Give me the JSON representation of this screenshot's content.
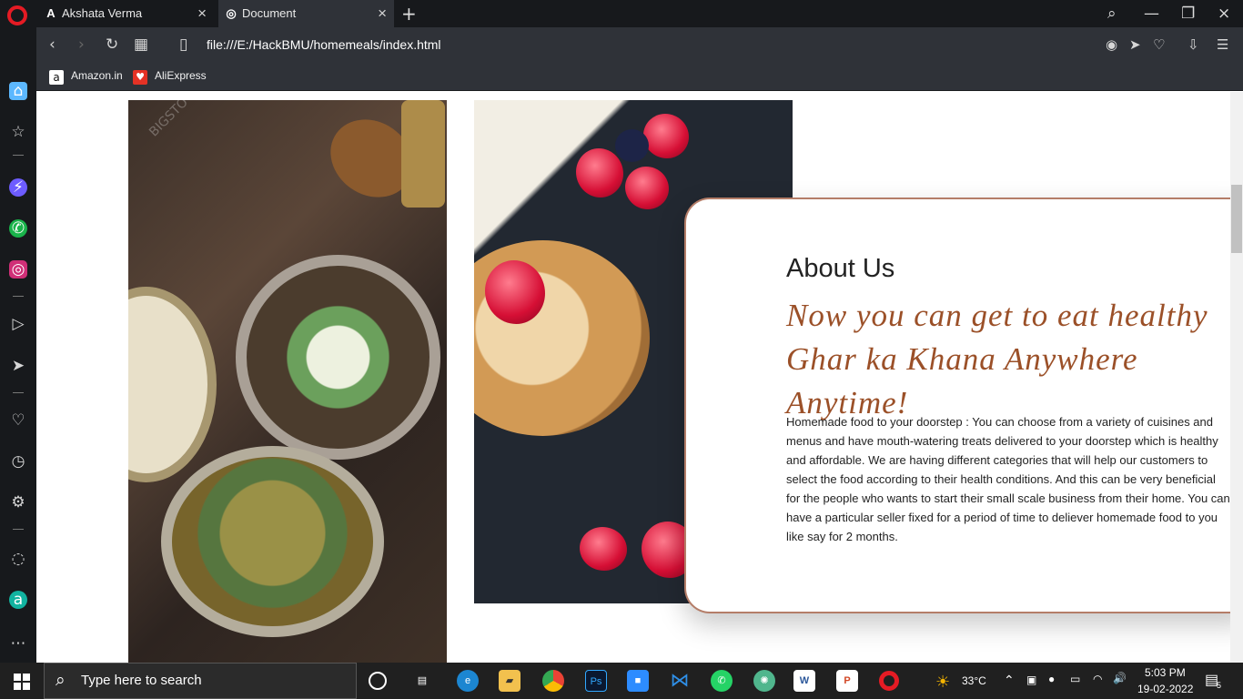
{
  "browser": {
    "tabs": [
      {
        "label": "Akshata Verma",
        "icon": "A"
      },
      {
        "label": "Document",
        "icon": "◎"
      }
    ],
    "url": "file:///E:/HackBMU/homemeals/index.html",
    "bookmarks": [
      {
        "label": "Amazon.in",
        "icon": "a"
      },
      {
        "label": "AliExpress",
        "icon": "♥"
      }
    ]
  },
  "page": {
    "section_title": "About Us",
    "tagline": "Now you can get to eat healthy Ghar ka Khana Anywhere Anytime!",
    "description": "Homemade food to your doorstep :  You can choose from a variety of cuisines and menus and have mouth-watering treats delivered to your doorstep which is healthy and affordable. We are having different categories that will help our customers to select the food according to their health conditions. And this can be very beneficial for the people who wants to start their small scale business from their home. You can have a particular seller fixed for a period of time to deliever homemade food to you like say for 2 months."
  },
  "taskbar": {
    "search_placeholder": "Type here to search",
    "weather": "33°C",
    "time": "5:03 PM",
    "date": "19-02-2022",
    "notification_count": "5",
    "apps": [
      "edge",
      "file-explorer",
      "chrome",
      "photoshop",
      "zoom",
      "vscode",
      "whatsapp",
      "chatgpt",
      "word",
      "powerpoint",
      "opera"
    ]
  },
  "colors": {
    "browser_dark": "#17191c",
    "browser_panel": "#2f3238",
    "accent": "#9b5028",
    "card_border": "#b47d68"
  }
}
